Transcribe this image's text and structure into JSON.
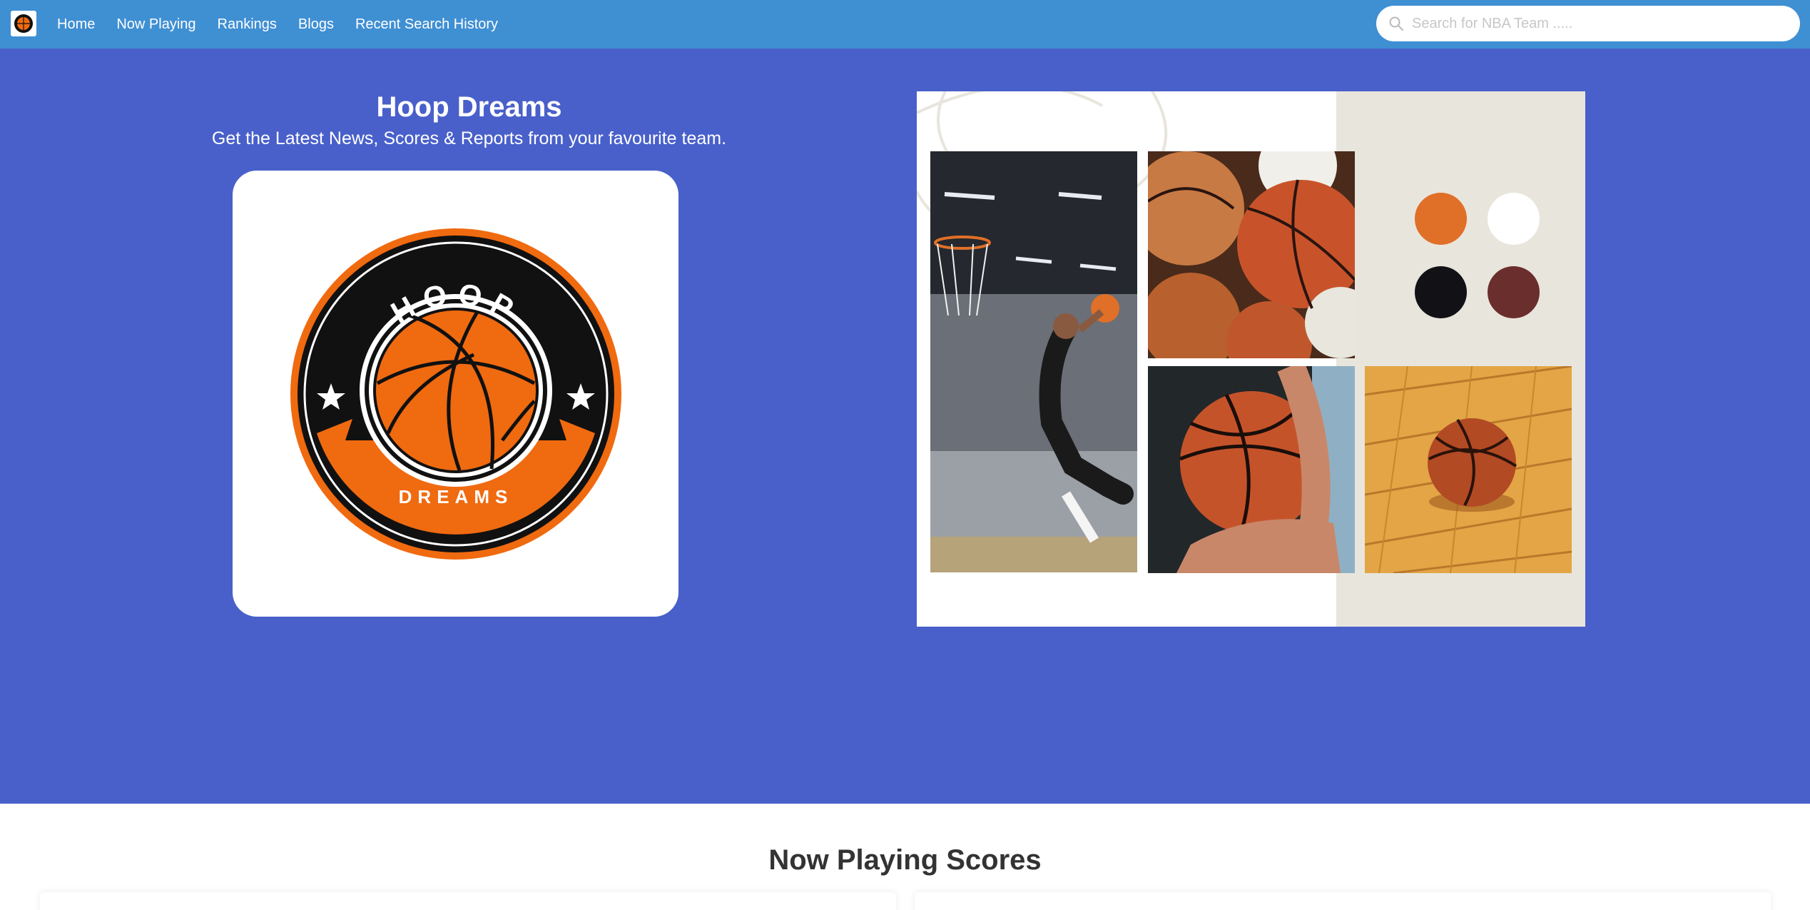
{
  "nav": {
    "links": [
      "Home",
      "Now Playing",
      "Rankings",
      "Blogs",
      "Recent Search History"
    ],
    "search_placeholder": "Search for NBA Team ....."
  },
  "hero": {
    "title": "Hoop Dreams",
    "subtitle": "Get the Latest News, Scores & Reports from your favourite team.",
    "logo_top_text": "HOOP",
    "logo_bottom_text": "DREAMS"
  },
  "palette": {
    "brand_orange": "#e06f28",
    "white": "#ffffff",
    "black": "#111116",
    "brown": "#6a2e2c",
    "nav_blue": "#3f8fd3",
    "hero_blue": "#4960ca"
  },
  "collage": {
    "photos": [
      "player-dunk-photo",
      "basketball-pile-photo",
      "ball-in-hand-photo",
      "ball-on-floor-photo"
    ]
  },
  "scores": {
    "title": "Now Playing Scores"
  }
}
